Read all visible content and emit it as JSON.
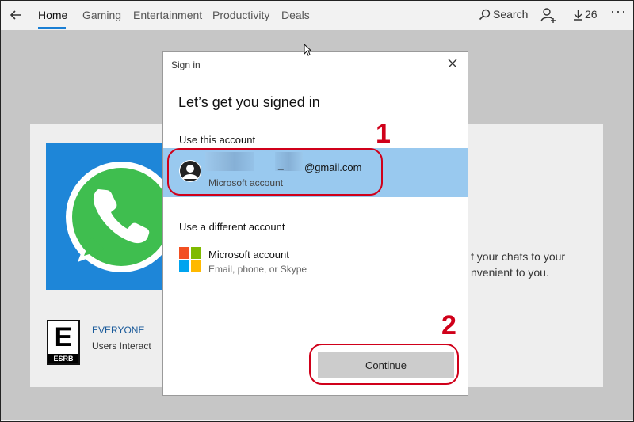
{
  "nav": {
    "tabs": [
      {
        "label": "Home",
        "active": true
      },
      {
        "label": "Gaming",
        "active": false
      },
      {
        "label": "Entertainment",
        "active": false
      },
      {
        "label": "Productivity",
        "active": false
      },
      {
        "label": "Deals",
        "active": false
      }
    ],
    "search_label": "Search",
    "downloads_count": "26",
    "more_label": "···",
    "accent_color": "#1a7fd4"
  },
  "card": {
    "rating_title": "EVERYONE",
    "rating_sub": "Users Interact",
    "rating_letter": "E",
    "rating_org": "ESRB",
    "desc_line1": "f your chats to your",
    "desc_line2": "nvenient to you."
  },
  "dialog": {
    "title": "Sign in",
    "heading": "Let’s get you signed in",
    "section_use_this": "Use this account",
    "account_email_dash": "_",
    "account_email_suffix": "@gmail.com",
    "account_type": "Microsoft account",
    "section_use_different": "Use a different account",
    "ms_title": "Microsoft account",
    "ms_sub": "Email, phone, or Skype",
    "continue_label": "Continue",
    "selected_row_color": "#99c9ef"
  },
  "annotations": {
    "step1": "1",
    "step2": "2",
    "color": "#d0001a"
  }
}
